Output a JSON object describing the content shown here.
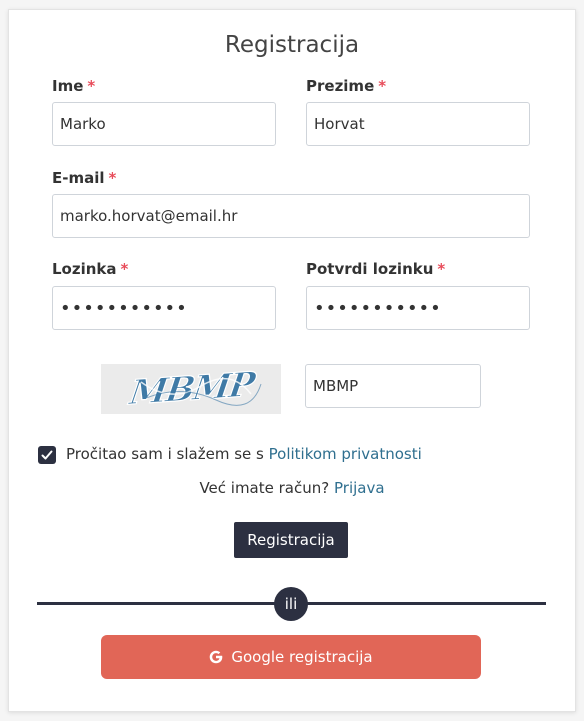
{
  "form": {
    "title": "Registracija",
    "required_mark": "*",
    "first_name": {
      "label": "Ime",
      "value": "Marko"
    },
    "last_name": {
      "label": "Prezime",
      "value": "Horvat"
    },
    "email": {
      "label": "E-mail",
      "value": "marko.horvat@email.hr"
    },
    "password": {
      "label": "Lozinka",
      "value": "•••••••••••"
    },
    "confirm_password": {
      "label": "Potvrdi lozinku",
      "value": "•••••••••••"
    },
    "captcha": {
      "image_text": "MBMP",
      "value": "MBMP"
    },
    "terms": {
      "checked": true,
      "text": "Pročitao sam i slažem se s",
      "link_text": "Politikom privatnosti"
    },
    "login_prompt": {
      "text": "Već imate račun?",
      "link_text": "Prijava"
    },
    "submit_label": "Registracija",
    "divider_text": "ili",
    "google_label": "Google registracija",
    "google_icon": "google-g-icon"
  },
  "colors": {
    "required": "#e84d5b",
    "link": "#2f6f8f",
    "dark": "#2c3041",
    "google": "#e16657"
  }
}
